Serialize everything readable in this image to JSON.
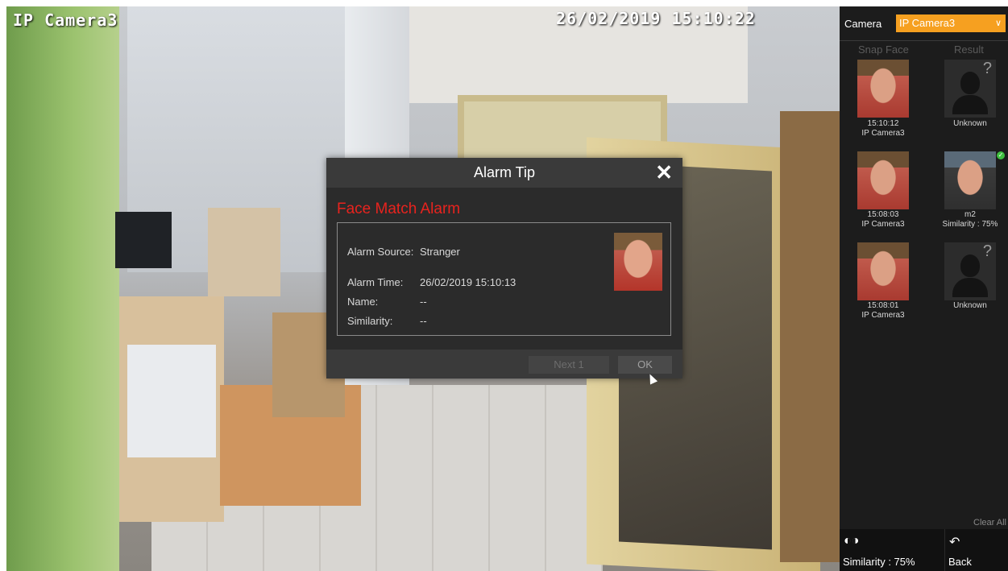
{
  "camera_view": {
    "title": "IP Camera3",
    "timestamp": "26/02/2019 15:10:22"
  },
  "dialog": {
    "title": "Alarm Tip",
    "close_icon": "close-icon",
    "alarm_type": "Face Match Alarm",
    "rows": [
      {
        "key": "Alarm Source:",
        "value": "Stranger"
      },
      {
        "key": "Alarm Time:",
        "value": "26/02/2019 15:10:13"
      },
      {
        "key": "Name:",
        "value": "--"
      },
      {
        "key": "Similarity:",
        "value": "--"
      }
    ],
    "next_label": "Next 1",
    "ok_label": "OK"
  },
  "panel": {
    "camera_label": "Camera",
    "camera_value": "IP Camera3",
    "col_snap": "Snap Face",
    "col_result": "Result",
    "rows": [
      {
        "time": "15:10:12",
        "camera": "IP Camera3",
        "result": "Unknown",
        "similarity": ""
      },
      {
        "time": "15:08:03",
        "camera": "IP Camera3",
        "result": "m2",
        "similarity": "Similarity : 75%"
      },
      {
        "time": "15:08:01",
        "camera": "IP Camera3",
        "result": "Unknown",
        "similarity": ""
      }
    ],
    "clear_all": "Clear All",
    "similarity_label": "Similarity : 75%",
    "back_label": "Back"
  },
  "colors": {
    "accent": "#f6a020",
    "alarm_red": "#e8231e",
    "match_green": "#3fbf3f"
  }
}
